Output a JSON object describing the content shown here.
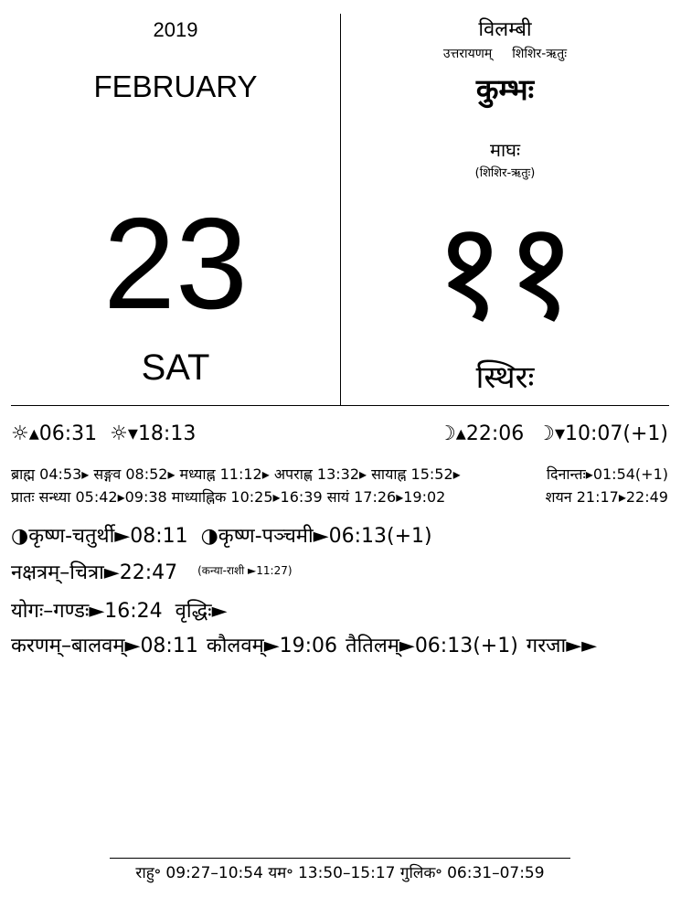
{
  "header": {
    "year": "2019",
    "month": "FEBRUARY",
    "day": "23",
    "weekday": "SAT",
    "samvatsara": "विलम्बी",
    "ayana": "उत्तरायणम्",
    "ritu": "शिशिर-ऋतुः",
    "rashi": "कुम्भः",
    "masa": "माघः",
    "masa_ritu": "(शिशिर-ऋतुः)",
    "masa_day": "११",
    "weekday_sanskrit": "स्थिरः"
  },
  "sun": {
    "sunrise": "☼▴06:31",
    "sunset": "☼▾18:13"
  },
  "moon": {
    "moonrise": "☽▴22:06",
    "moonset": "☽▾10:07(+1)"
  },
  "muhurta": {
    "line1": "ब्राह्म 04:53▸ सङ्गव 08:52▸ मध्याह्न 11:12▸ अपराह्ण 13:32▸ सायाह्न 15:52▸",
    "dinanta": "दिनान्तः▸01:54(+1)",
    "line2": "प्रातः सन्ध्या 05:42▸09:38 माध्याह्निक 10:25▸16:39 सायं 17:26▸19:02",
    "shayana": "शयन 21:17▸22:49"
  },
  "tithi": {
    "item1": "◑कृष्ण-चतुर्थी►08:11",
    "item2": "◑कृष्ण-पञ्चमी►06:13(+1)"
  },
  "nakshatra": {
    "main": "नक्षत्रम्–चित्रा►22:47",
    "rashi_note": "(कन्या-राशी ►11:27)"
  },
  "yoga": {
    "main": "योगः–गण्डः►16:24",
    "next": "वृद्धिः►"
  },
  "karana": {
    "line": "करणम्–बालवम्►08:11 कौलवम्►19:06 तैतिलम्►06:13(+1) गरजा►►"
  },
  "footer": {
    "text": "राहु॰ 09:27–10:54 यम॰ 13:50–15:17 गुलिक॰ 06:31–07:59"
  }
}
